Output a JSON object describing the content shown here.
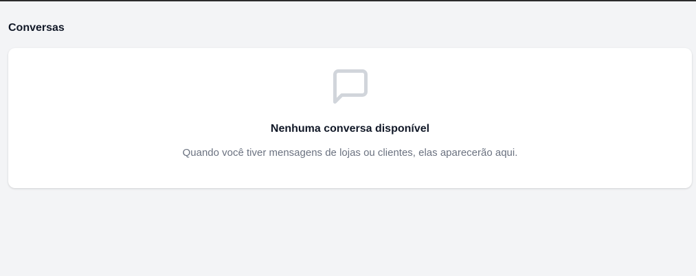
{
  "page": {
    "title": "Conversas"
  },
  "empty_state": {
    "icon": "message-square-icon",
    "title": "Nenhuma conversa disponível",
    "description": "Quando você tiver mensagens de lojas ou clientes, elas aparecerão aqui."
  },
  "colors": {
    "background": "#f3f4f6",
    "card": "#ffffff",
    "title_text": "#111827",
    "description_text": "#6b7280",
    "icon": "#d1d5db"
  }
}
